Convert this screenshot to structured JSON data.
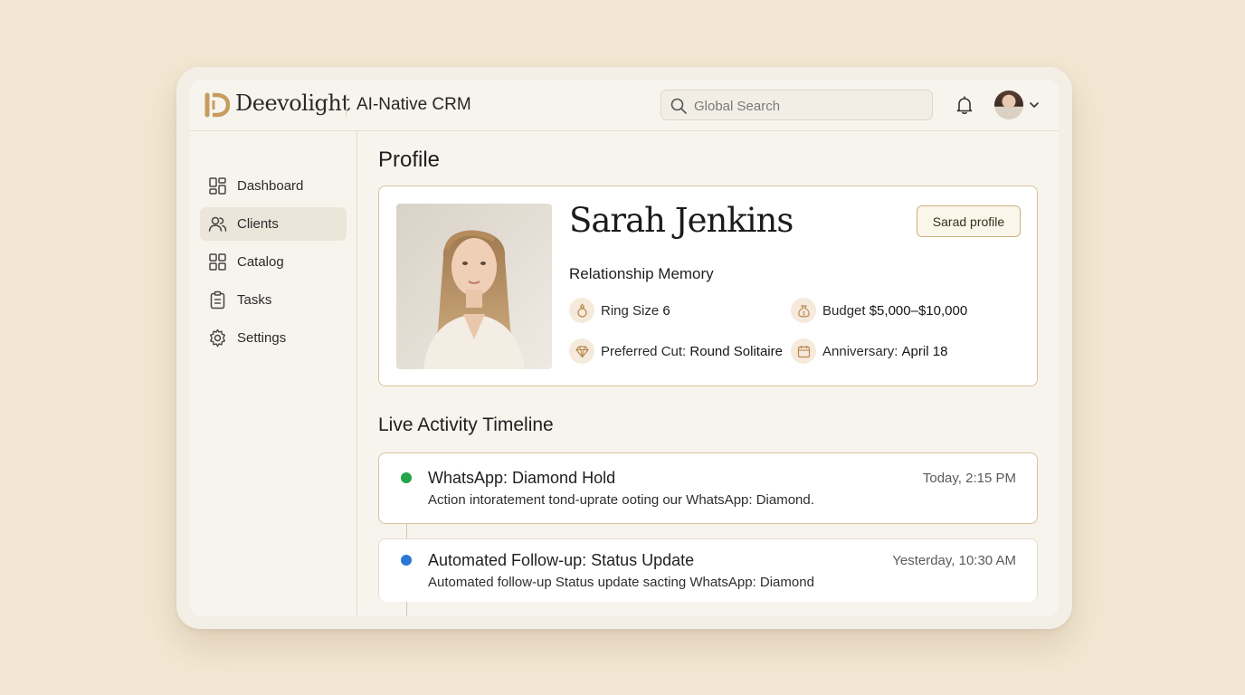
{
  "header": {
    "brand": "Deevolight",
    "product": "AI-Native CRM",
    "search_placeholder": "Global Search"
  },
  "sidebar": {
    "items": [
      {
        "label": "Dashboard",
        "icon": "dashboard-icon"
      },
      {
        "label": "Clients",
        "icon": "users-icon",
        "active": true
      },
      {
        "label": "Catalog",
        "icon": "catalog-icon"
      },
      {
        "label": "Tasks",
        "icon": "clipboard-icon"
      },
      {
        "label": "Settings",
        "icon": "gear-icon"
      }
    ]
  },
  "profile": {
    "heading": "Profile",
    "name": "Sarah Jenkins",
    "button": "Sarad profile",
    "memory_title": "Relationship Memory",
    "facts": {
      "ring_label": "Ring Size",
      "ring_value": "6",
      "budget_label": "Budget",
      "budget_value": "$5,000–$10,000",
      "cut_label": "Preferred Cut:",
      "cut_value": "Round Solitaire",
      "anniversary_label": "Anniversary:",
      "anniversary_value": "April 18"
    }
  },
  "timeline": {
    "heading": "Live Activity Timeline",
    "events": [
      {
        "title": "WhatsApp: Diamond Hold",
        "description": "Action intoratement tond-uprate ooting our WhatsApp: Diamond.",
        "time": "Today, 2:15 PM",
        "dot_color": "#22a447"
      },
      {
        "title": "Automated Follow-up: Status Update",
        "description": "Automated follow-up Status update sacting WhatsApp: Diamond",
        "time": "Yesterday, 10:30 AM",
        "dot_color": "#2b78d4"
      }
    ]
  },
  "colors": {
    "accent_gold": "#c9a46a",
    "background": "#f3e7d3"
  }
}
